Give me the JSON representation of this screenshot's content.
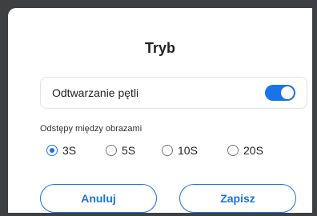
{
  "dialog": {
    "title": "Tryb",
    "loop_toggle": {
      "label": "Odtwarzanie pętli",
      "on": true
    },
    "interval": {
      "label": "Odstępy między obrazami",
      "options": [
        "3S",
        "5S",
        "10S",
        "20S"
      ],
      "selected": "3S"
    },
    "buttons": {
      "cancel": "Anuluj",
      "save": "Zapisz"
    }
  },
  "colors": {
    "accent": "#1a73e8",
    "backdrop": "#3d3f42"
  }
}
